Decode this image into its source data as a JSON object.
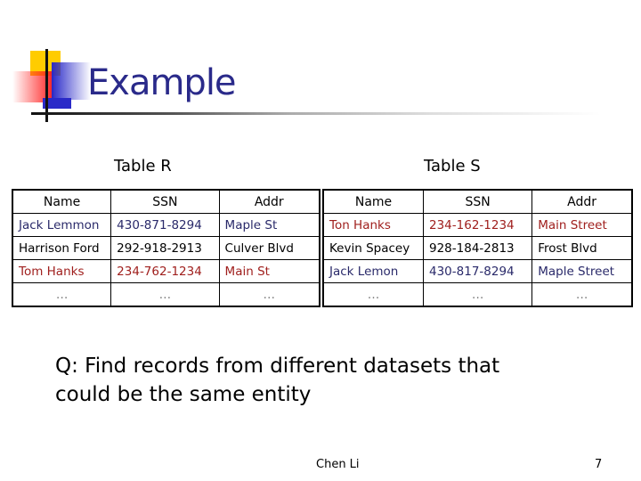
{
  "slide": {
    "title": "Example",
    "question": "Q: Find records from different datasets that could be the same entity",
    "question_lines": [
      "Q: Find records from different datasets that",
      "could be the same entity"
    ],
    "author": "Chen Li",
    "page_number": "7"
  },
  "colors": {
    "title": "#2a2a8a",
    "match_red": "#a0201e",
    "match_blue": "#2a2a6a",
    "text": "#000000"
  },
  "table_r": {
    "caption": "Table R",
    "columns": [
      "Name",
      "SSN",
      "Addr"
    ],
    "rows": [
      {
        "cells": [
          "Jack Lemmon",
          "430-871-8294",
          "Maple St"
        ],
        "color": "blue"
      },
      {
        "cells": [
          "Harrison Ford",
          "292-918-2913",
          "Culver Blvd"
        ],
        "color": "black"
      },
      {
        "cells": [
          "Tom Hanks",
          "234-762-1234",
          "Main St"
        ],
        "color": "red"
      },
      {
        "cells": [
          "…",
          "…",
          "…"
        ],
        "color": "gray"
      }
    ]
  },
  "table_s": {
    "caption": "Table S",
    "columns": [
      "Name",
      "SSN",
      "Addr"
    ],
    "rows": [
      {
        "cells": [
          "Ton Hanks",
          "234-162-1234",
          "Main Street"
        ],
        "color": "red"
      },
      {
        "cells": [
          "Kevin Spacey",
          "928-184-2813",
          "Frost Blvd"
        ],
        "color": "black"
      },
      {
        "cells": [
          "Jack Lemon",
          "430-817-8294",
          "Maple Street"
        ],
        "color": "blue"
      },
      {
        "cells": [
          "…",
          "…",
          "…"
        ],
        "color": "gray"
      }
    ]
  }
}
